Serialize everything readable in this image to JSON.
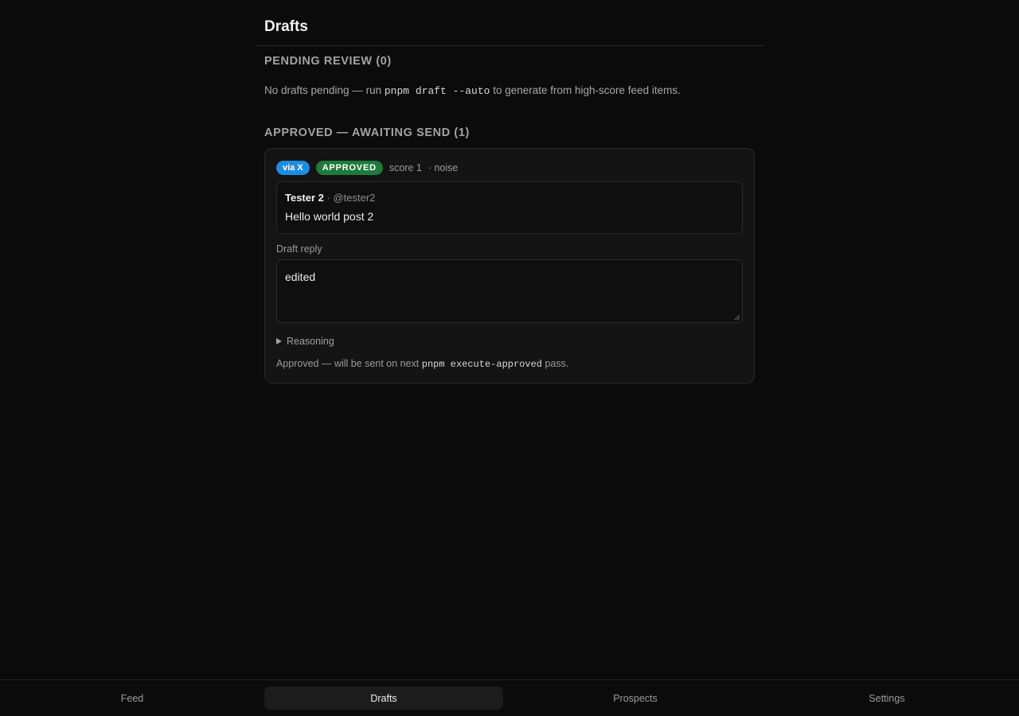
{
  "header": {
    "title": "Drafts"
  },
  "pending": {
    "heading": "PENDING REVIEW (0)",
    "empty_prefix": "No drafts pending — run ",
    "empty_code": "pnpm draft --auto",
    "empty_suffix": " to generate from high-score feed items."
  },
  "approved": {
    "heading": "APPROVED — AWAITING SEND (1)",
    "items": [
      {
        "source_badge": "via X",
        "status_badge": "APPROVED",
        "score": "score 1",
        "classification": "· noise",
        "post": {
          "author": "Tester 2",
          "handle": " · @tester2",
          "text": "Hello world post 2"
        },
        "reply_label": "Draft reply",
        "reply_text": "edited",
        "reasoning_label": "Reasoning",
        "footnote_prefix": "Approved — will be sent on next ",
        "footnote_code": "pnpm execute-approved",
        "footnote_suffix": " pass."
      }
    ]
  },
  "nav": {
    "tabs": [
      {
        "label": "Feed",
        "active": false
      },
      {
        "label": "Drafts",
        "active": true
      },
      {
        "label": "Prospects",
        "active": false
      },
      {
        "label": "Settings",
        "active": false
      }
    ]
  },
  "colors": {
    "background": "#0b0b0b",
    "source_badge": "#1d8ce0",
    "status_badge": "#1f7a3c",
    "active_tab": "#1c1c1c"
  },
  "icons": {
    "reasoning_toggle": "triangle-right-icon",
    "textarea_resize": "resize-handle-icon"
  }
}
